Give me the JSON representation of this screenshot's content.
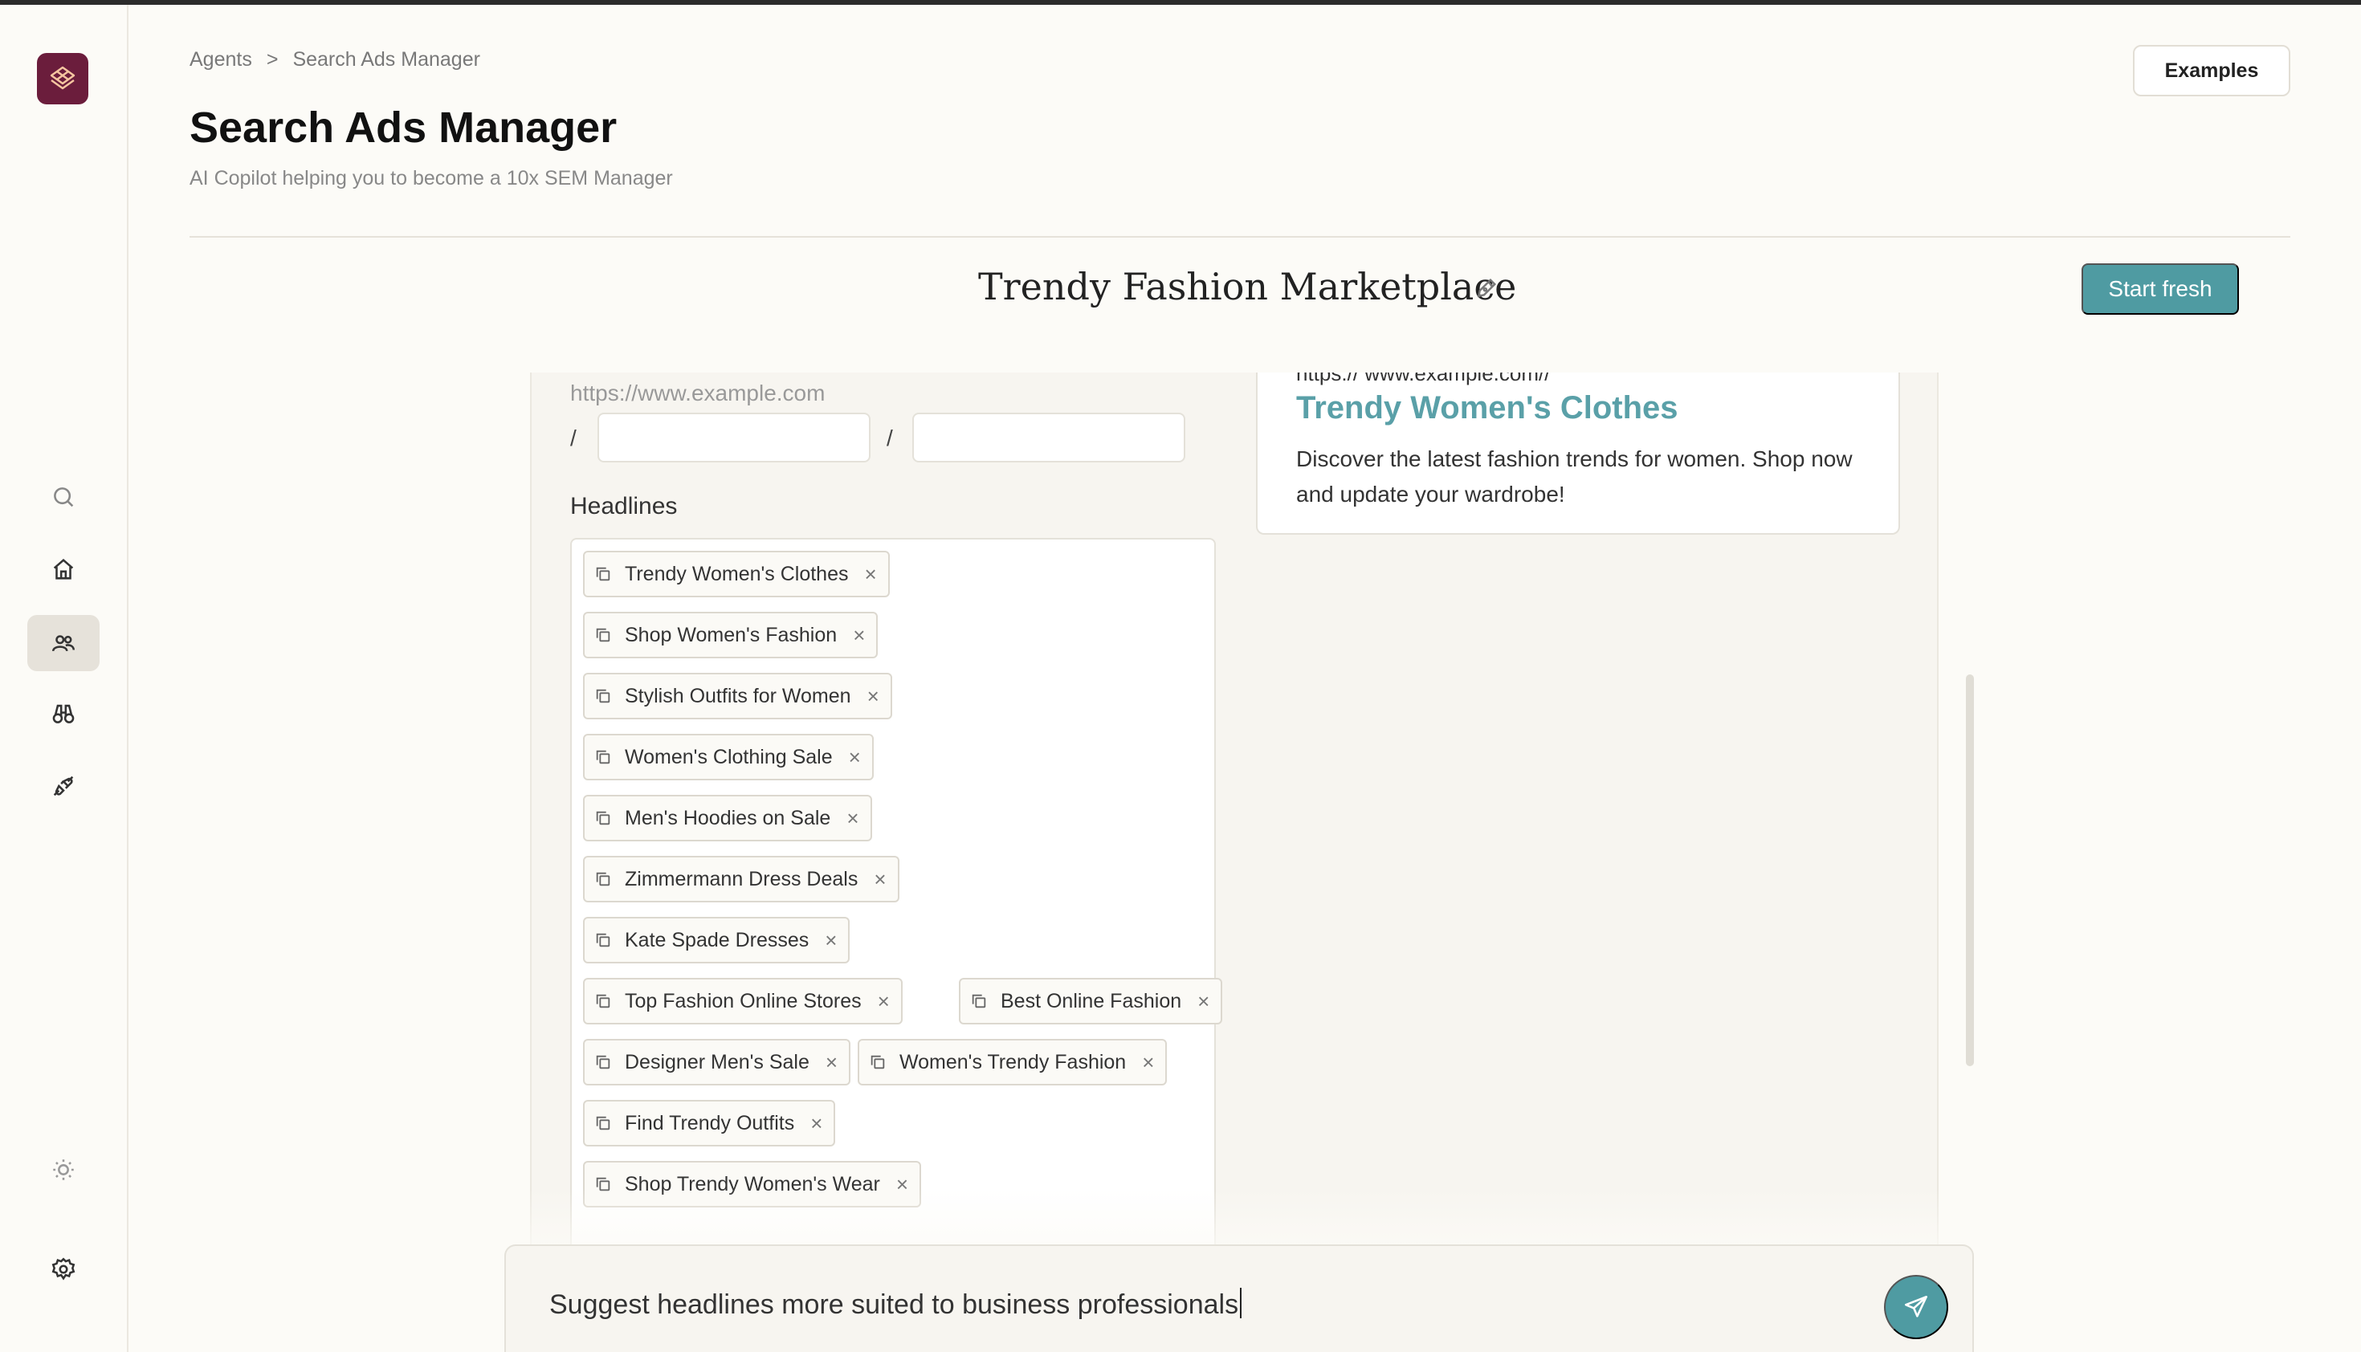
{
  "breadcrumb": {
    "root": "Agents",
    "separator": ">",
    "current": "Search Ads Manager"
  },
  "header": {
    "title": "Search Ads Manager",
    "subtitle": "AI Copilot helping you to become a 10x SEM Manager",
    "examples_label": "Examples"
  },
  "project": {
    "title": "Trendy Fashion Marketplace",
    "start_fresh_label": "Start fresh"
  },
  "sidebar": {
    "icons": [
      "brand-logo",
      "search-icon",
      "home-icon",
      "users-icon",
      "binoculars-icon",
      "plug-icon",
      "sun-icon",
      "gear-icon"
    ],
    "active": "users-icon"
  },
  "form": {
    "url_placeholder": "https://www.example.com",
    "path_separator": "/",
    "path1_value": "",
    "path2_value": "",
    "headlines_label": "Headlines",
    "headlines": [
      "Trendy Women's Clothes",
      "Shop Women's Fashion",
      "Stylish Outfits for Women",
      "Women's Clothing Sale",
      "Men's Hoodies on Sale",
      "Zimmermann Dress Deals",
      "Kate Spade Dresses",
      "Top Fashion Online Stores",
      "Best Online Fashion",
      "Designer Men's Sale",
      "Women's Trendy Fashion",
      "Find Trendy Outfits",
      "Shop Trendy Women's Wear"
    ],
    "chip_remove": "×"
  },
  "ad_preview": {
    "url": "https:// www.example.com//",
    "headline": "Trendy Women's Clothes",
    "description": "Discover the latest fashion trends for women. Shop now and update your wardrobe!"
  },
  "chat": {
    "input_value": "Suggest headlines more suited to business professionals"
  },
  "colors": {
    "accent": "#4f9ba2",
    "brand": "#6b1d3c",
    "background": "#fcfbf7",
    "ad_headline": "#5aa0a8"
  }
}
